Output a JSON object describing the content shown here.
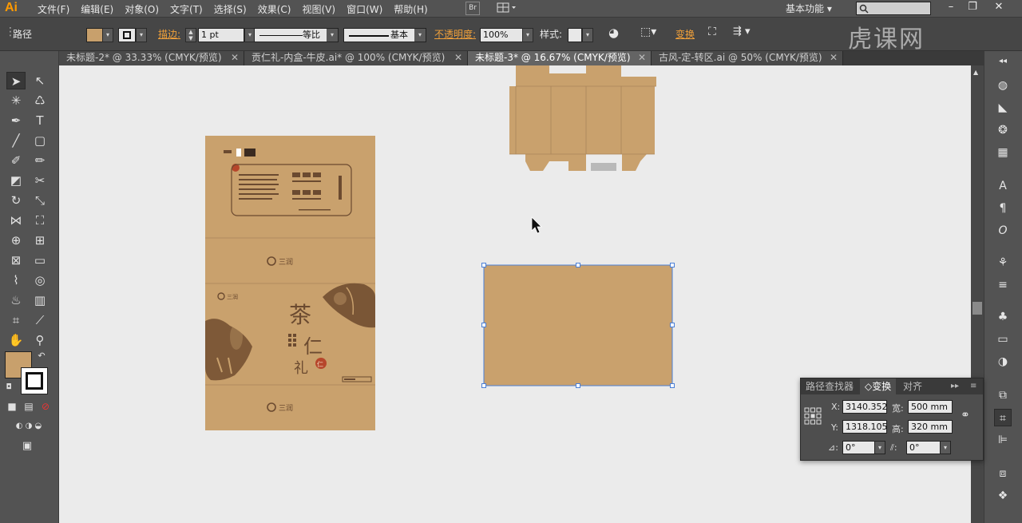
{
  "app": {
    "logo": "Ai",
    "menu": [
      "文件(F)",
      "编辑(E)",
      "对象(O)",
      "文字(T)",
      "选择(S)",
      "效果(C)",
      "视图(V)",
      "窗口(W)",
      "帮助(H)"
    ],
    "bridge_label": "Br",
    "workspace": "基本功能",
    "window_controls": [
      "–",
      "❐",
      "✕"
    ]
  },
  "control_bar": {
    "object_type": "路径",
    "fill_color": "#c8a06c",
    "stroke_label": "描边:",
    "stroke_weight": "1 pt",
    "stroke_profile": "等比",
    "brush_profile": "基本",
    "opacity_label": "不透明度:",
    "opacity_value": "100%",
    "style_label": "样式:",
    "transform_label": "变换"
  },
  "tabs": [
    {
      "label": "未标题-2* @ 33.33% (CMYK/预览)",
      "active": false
    },
    {
      "label": "贡仁礼-内盒-牛皮.ai* @ 100% (CMYK/预览)",
      "active": false
    },
    {
      "label": "未标题-3* @ 16.67% (CMYK/预览)",
      "active": true
    },
    {
      "label": "古风-定-转区.ai @ 50% (CMYK/预览)",
      "active": false
    }
  ],
  "tab_close": "✕",
  "artwork": {
    "kraft_color": "#c8a06c",
    "brand_text": "三润",
    "title_glyphs": [
      "茶",
      "仁",
      "礼"
    ],
    "seal_text": "仁"
  },
  "transform_panel": {
    "tabs": [
      "路径查找器",
      "◇变换",
      "对齐"
    ],
    "x_label": "X:",
    "x_value": "3140.352",
    "y_label": "Y:",
    "y_value": "1318.105",
    "w_label": "宽:",
    "w_value": "500 mm",
    "h_label": "高:",
    "h_value": "320 mm",
    "rotate_value": "0°",
    "shear_value": "0°"
  },
  "watermark": "虎课网"
}
